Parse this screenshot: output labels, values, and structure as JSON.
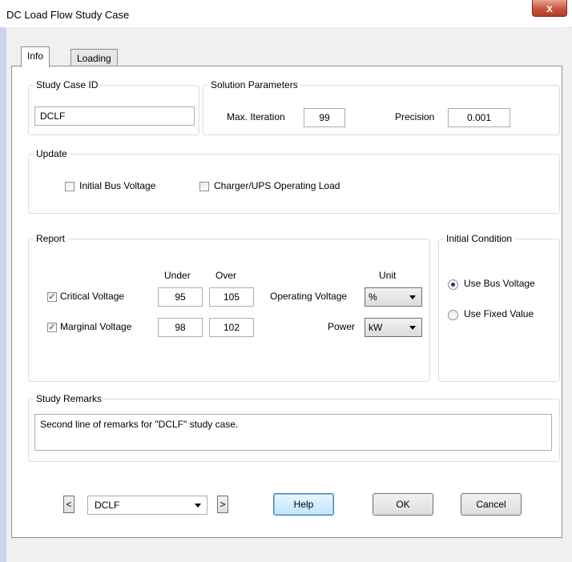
{
  "window": {
    "title": "DC Load Flow Study Case",
    "close_glyph": "x"
  },
  "tabs": [
    {
      "label": "Info"
    },
    {
      "label": "Loading"
    }
  ],
  "study_case_id": {
    "legend": "Study Case ID",
    "value": "DCLF"
  },
  "solution": {
    "legend": "Solution Parameters",
    "max_iteration_label": "Max. Iteration",
    "max_iteration_value": "99",
    "precision_label": "Precision",
    "precision_value": "0.001"
  },
  "update": {
    "legend": "Update",
    "initial_bus_voltage": {
      "label": "Initial Bus Voltage",
      "checked": false
    },
    "charger_ups": {
      "label": "Charger/UPS Operating Load",
      "checked": false
    }
  },
  "report": {
    "legend": "Report",
    "under_header": "Under",
    "over_header": "Over",
    "unit_header": "Unit",
    "check_glyph": "✓",
    "critical": {
      "label": "Critical Voltage",
      "checked": true,
      "under": "95",
      "over": "105"
    },
    "marginal": {
      "label": "Marginal Voltage",
      "checked": true,
      "under": "98",
      "over": "102"
    },
    "operating_voltage": {
      "label": "Operating Voltage",
      "value": "%"
    },
    "power": {
      "label": "Power",
      "value": "kW"
    }
  },
  "initial_condition": {
    "legend": "Initial Condition",
    "options": [
      {
        "label": "Use Bus Voltage",
        "selected": true
      },
      {
        "label": "Use Fixed Value",
        "selected": false
      }
    ]
  },
  "remarks": {
    "legend": "Study Remarks",
    "value": "Second line of remarks for \"DCLF\" study case."
  },
  "footer": {
    "prev_label": "<",
    "next_label": ">",
    "case_select": "DCLF",
    "help_label": "Help",
    "ok_label": "OK",
    "cancel_label": "Cancel"
  }
}
